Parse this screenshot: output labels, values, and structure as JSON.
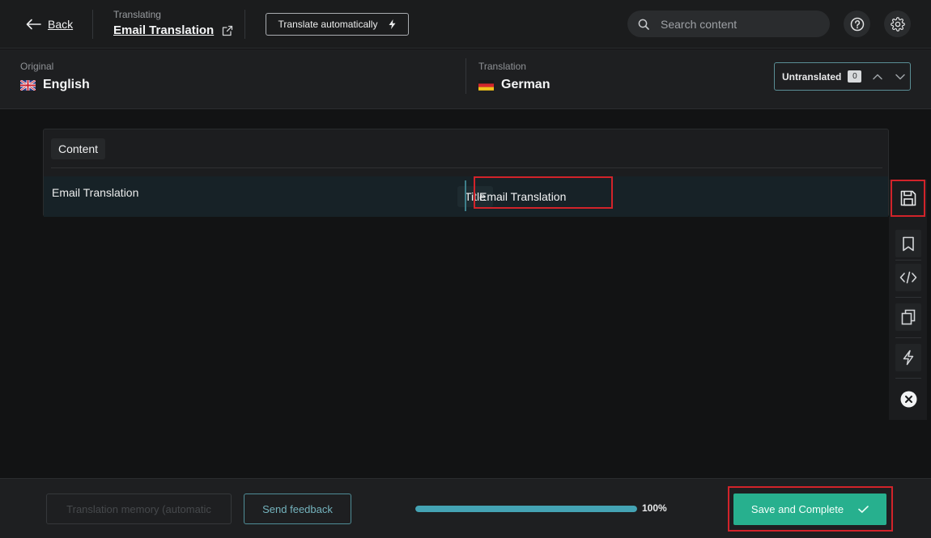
{
  "header": {
    "back_label": "Back",
    "translating_caption": "Translating",
    "document_title": "Email Translation",
    "translate_auto_label": "Translate automatically",
    "search_placeholder": "Search content"
  },
  "languages": {
    "original_caption": "Original",
    "original_language": "English",
    "translation_caption": "Translation",
    "translation_language": "German",
    "untranslated_label": "Untranslated",
    "untranslated_count": "0"
  },
  "content": {
    "section_label": "Content",
    "rows": [
      {
        "source_text": "Email Translation",
        "field_label": "Title",
        "translation_value": "Email Translation"
      }
    ]
  },
  "toolbar": {
    "icons": [
      "save-icon",
      "bookmark-icon",
      "code-icon",
      "copy-icon",
      "lightning-icon",
      "close-circle-icon"
    ]
  },
  "footer": {
    "translation_memory_label": "Translation memory (automatic",
    "send_feedback_label": "Send feedback",
    "progress_percent_label": "100%",
    "progress_fraction": 1.0,
    "save_complete_label": "Save and Complete"
  },
  "colors": {
    "accent_teal": "#27b08e",
    "highlight_red": "#d2232a",
    "progress_blue": "#44a3b4"
  }
}
